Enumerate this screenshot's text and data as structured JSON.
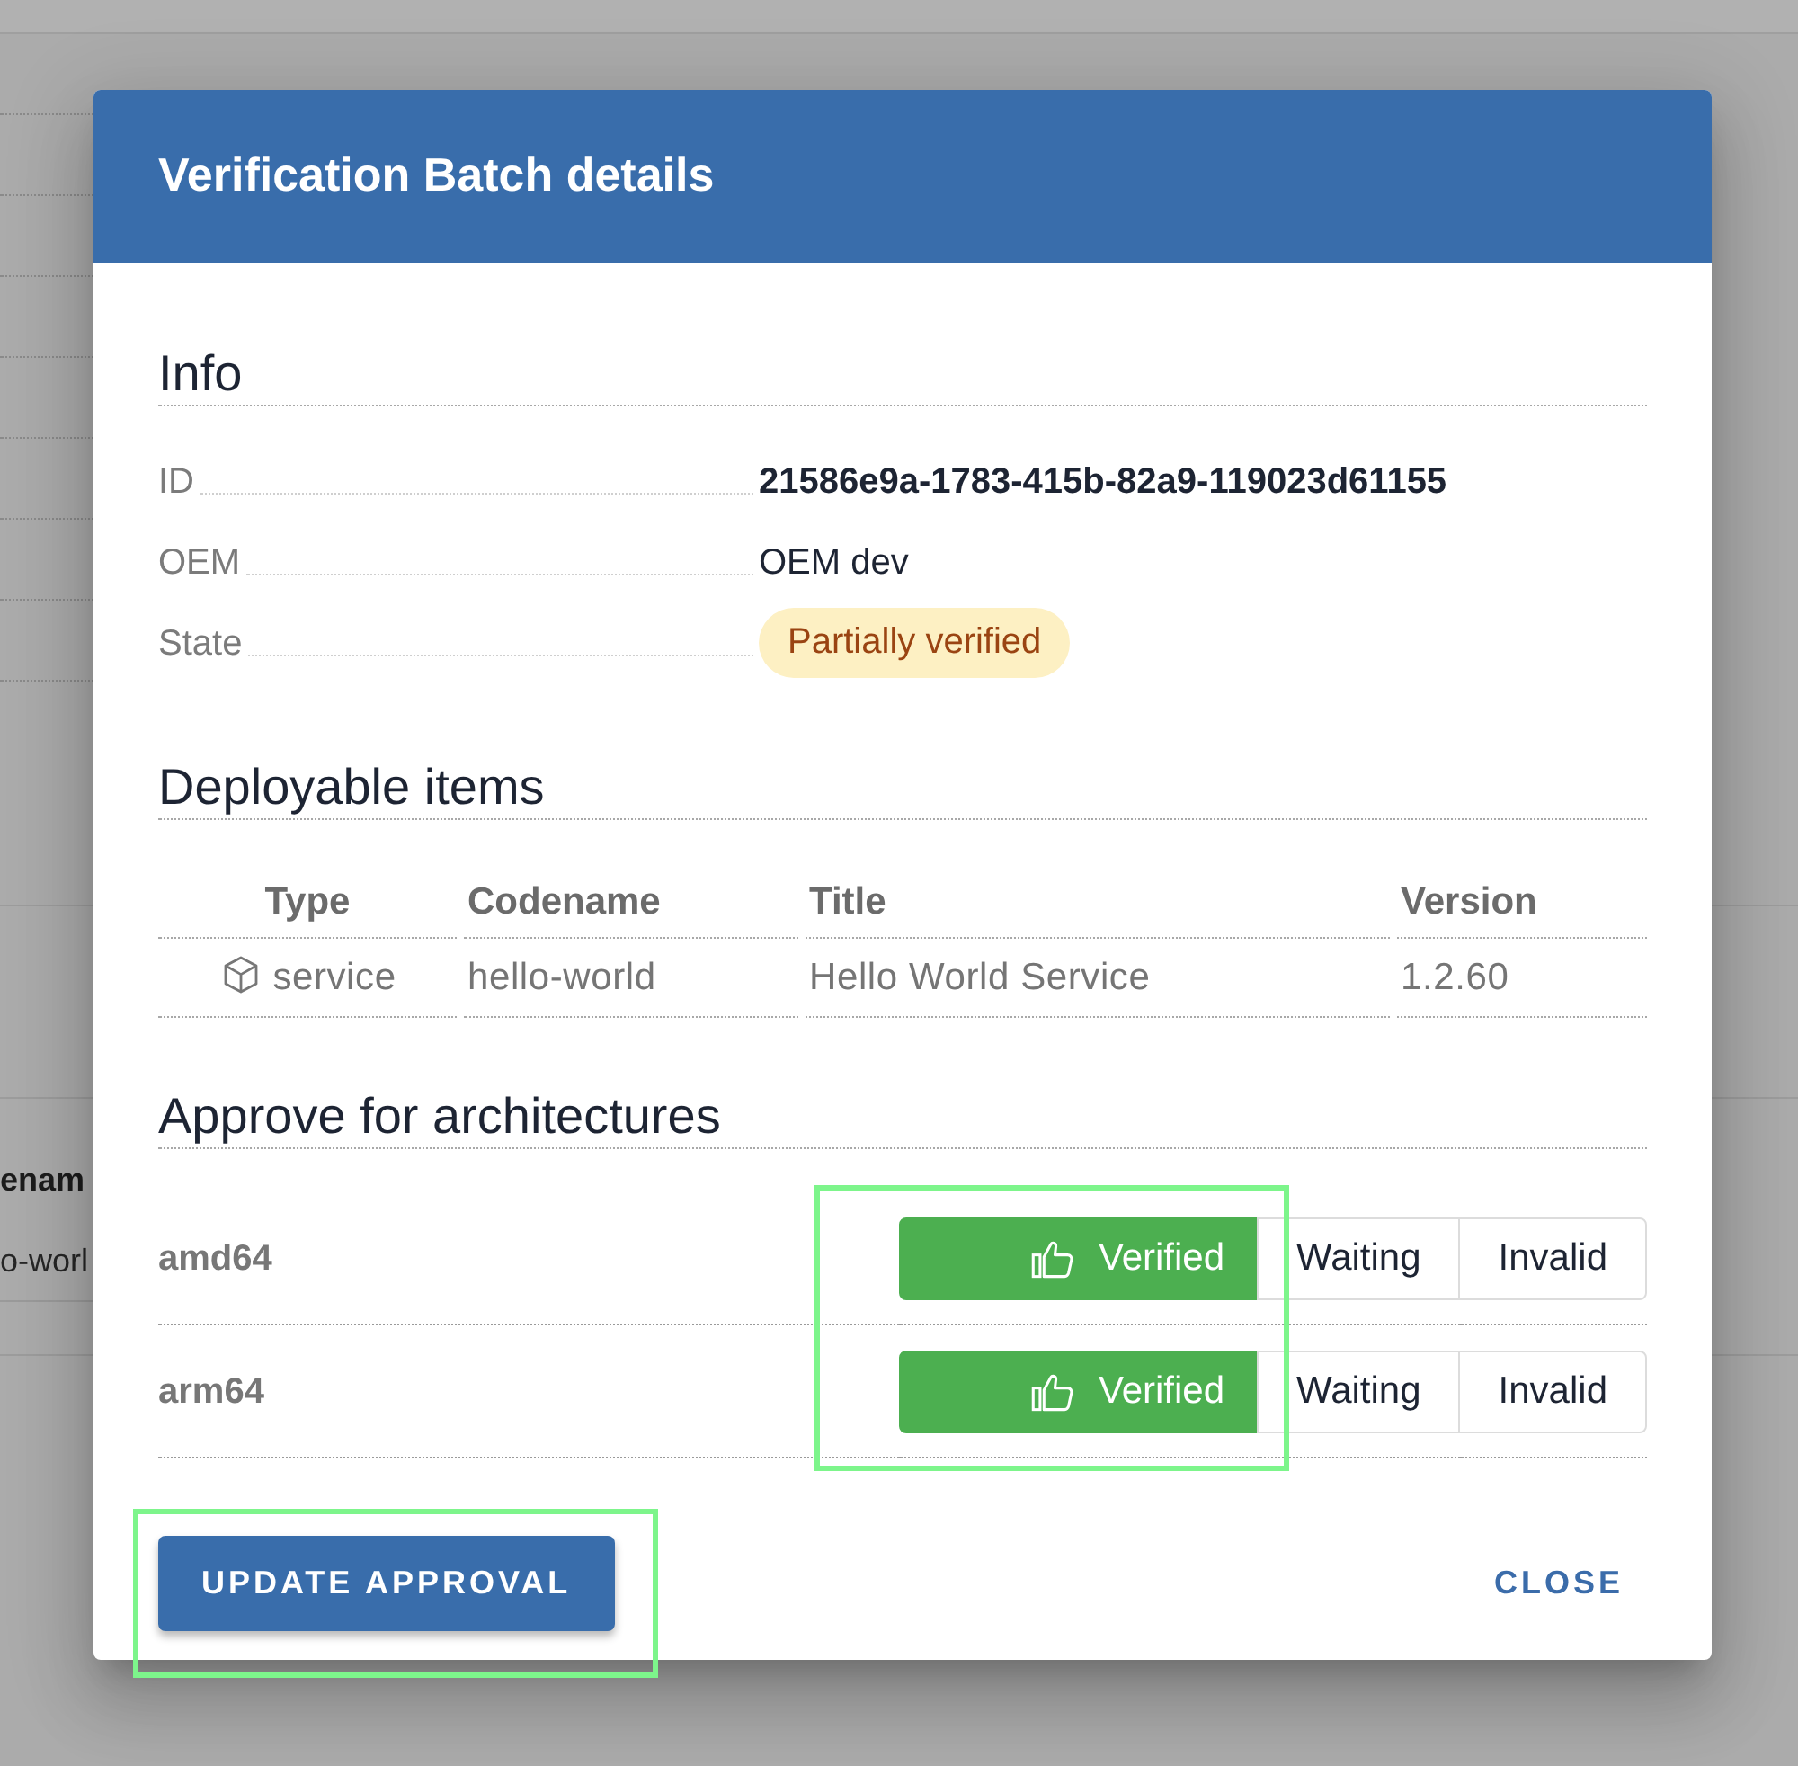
{
  "backdrop": {
    "header_fragment": "enam",
    "cell_fragment": "o-worl"
  },
  "dialog": {
    "title": "Verification Batch details"
  },
  "info": {
    "heading": "Info",
    "fields": [
      {
        "label": "ID",
        "value": "21586e9a-1783-415b-82a9-119023d61155",
        "kind": "id"
      },
      {
        "label": "OEM",
        "value": "OEM dev",
        "kind": "text"
      },
      {
        "label": "State",
        "value": "Partially verified",
        "kind": "badge"
      }
    ]
  },
  "deployable_items": {
    "heading": "Deployable items",
    "columns": [
      "Type",
      "Codename",
      "Title",
      "Version"
    ],
    "rows": [
      {
        "cells": [
          "service",
          "hello-world",
          "Hello World Service",
          "1.2.60"
        ]
      }
    ]
  },
  "architectures": {
    "heading": "Approve for architectures",
    "rows": [
      {
        "name": "amd64",
        "options": [
          {
            "kind": "verified",
            "label": "Verified",
            "selected": true,
            "highlighted": true
          },
          {
            "kind": "waiting",
            "label": "Waiting",
            "selected": false,
            "highlighted": false
          },
          {
            "kind": "invalid",
            "label": "Invalid",
            "selected": false,
            "highlighted": false
          }
        ]
      },
      {
        "name": "arm64",
        "options": [
          {
            "kind": "verified",
            "label": "Verified",
            "selected": true,
            "highlighted": true
          },
          {
            "kind": "waiting",
            "label": "Waiting",
            "selected": false,
            "highlighted": false
          },
          {
            "kind": "invalid",
            "label": "Invalid",
            "selected": false,
            "highlighted": false
          }
        ]
      }
    ]
  },
  "footer": {
    "update_button": {
      "label": "UPDATE APPROVAL",
      "highlighted": true
    },
    "close_button": {
      "label": "CLOSE"
    }
  }
}
